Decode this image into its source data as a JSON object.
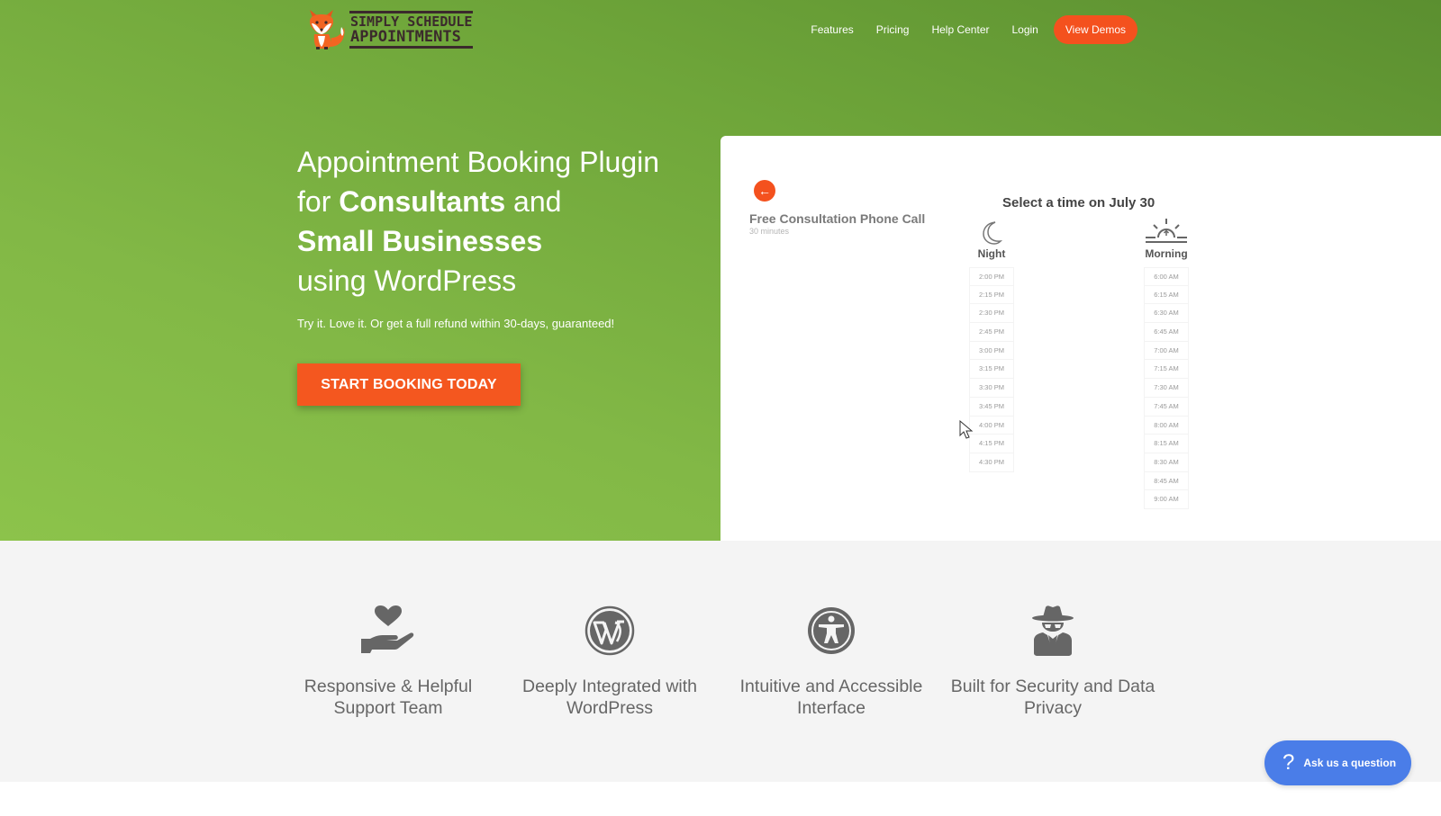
{
  "brand": {
    "logo_line1": "SIMPLY SCHEDULE",
    "logo_line2": "APPOINTMENTS",
    "accent": "#f4511e",
    "green_dark": "#5b8f30",
    "green_light": "#8cc34b"
  },
  "nav": {
    "items": [
      "Features",
      "Pricing",
      "Help Center",
      "Login"
    ],
    "cta": "View Demos"
  },
  "hero": {
    "line1": "Appointment Booking Plugin",
    "line2_pre": "for ",
    "line2_bold": "Consultants",
    "line2_post": " and",
    "line3_bold": "Small Businesses",
    "line4": "using WordPress",
    "subtext": "Try it. Love it. Or get a full refund within 30-days, guaranteed!",
    "button": "START BOOKING TODAY"
  },
  "booking": {
    "back_icon": "arrow-left-icon",
    "service_title": "Free Consultation Phone Call",
    "service_duration": "30 minutes",
    "select_title": "Select a time on July 30",
    "columns": [
      {
        "label": "Night",
        "icon": "moon-icon",
        "slots": [
          "2:00 PM",
          "2:15 PM",
          "2:30 PM",
          "2:45 PM",
          "3:00 PM",
          "3:15 PM",
          "3:30 PM",
          "3:45 PM",
          "4:00 PM",
          "4:15 PM",
          "4:30 PM"
        ]
      },
      {
        "label": "Morning",
        "icon": "sunrise-icon",
        "slots": [
          "6:00 AM",
          "6:15 AM",
          "6:30 AM",
          "6:45 AM",
          "7:00 AM",
          "7:15 AM",
          "7:30 AM",
          "7:45 AM",
          "8:00 AM",
          "8:15 AM",
          "8:30 AM",
          "8:45 AM",
          "9:00 AM"
        ]
      }
    ]
  },
  "features": [
    {
      "icon": "hand-heart-icon",
      "text": "Responsive & Helpful Support Team"
    },
    {
      "icon": "wordpress-icon",
      "text": "Deeply Integrated with WordPress"
    },
    {
      "icon": "accessibility-icon",
      "text": "Intuitive and Accessible Interface"
    },
    {
      "icon": "user-secret-icon",
      "text": "Built for Security and Data Privacy"
    }
  ],
  "help_widget": {
    "icon": "question-icon",
    "label": "Ask us a question"
  }
}
